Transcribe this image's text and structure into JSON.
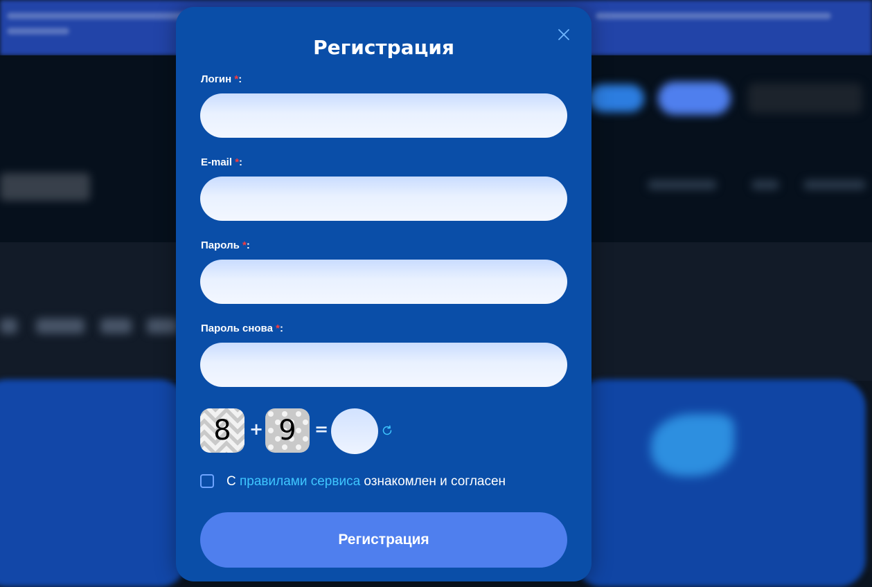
{
  "modal": {
    "title": "Регистрация",
    "close_icon": "close-icon",
    "fields": [
      {
        "label": "Логин",
        "required_mark": "*",
        "suffix": ":",
        "value": "",
        "placeholder": ""
      },
      {
        "label": "E-mail",
        "required_mark": "*",
        "suffix": ":",
        "value": "",
        "placeholder": ""
      },
      {
        "label": "Пароль",
        "required_mark": "*",
        "suffix": ":",
        "value": "",
        "placeholder": ""
      },
      {
        "label": "Пароль снова",
        "required_mark": "*",
        "suffix": ":",
        "value": "",
        "placeholder": ""
      }
    ],
    "captcha": {
      "first": "8",
      "operator": "+",
      "second": "9",
      "equals": "=",
      "answer": "",
      "refresh_icon": "refresh-icon"
    },
    "agreement": {
      "prefix": "С ",
      "link": "правилами сервиса",
      "suffix": " ознакомлен и согласен",
      "checked": false
    },
    "submit_label": "Регистрация"
  },
  "colors": {
    "modal_bg": "#0a4ea8",
    "submit_bg": "#4f7fee",
    "link": "#3fc6ff",
    "required": "#ff3b3b",
    "close": "#6fb6ff"
  }
}
